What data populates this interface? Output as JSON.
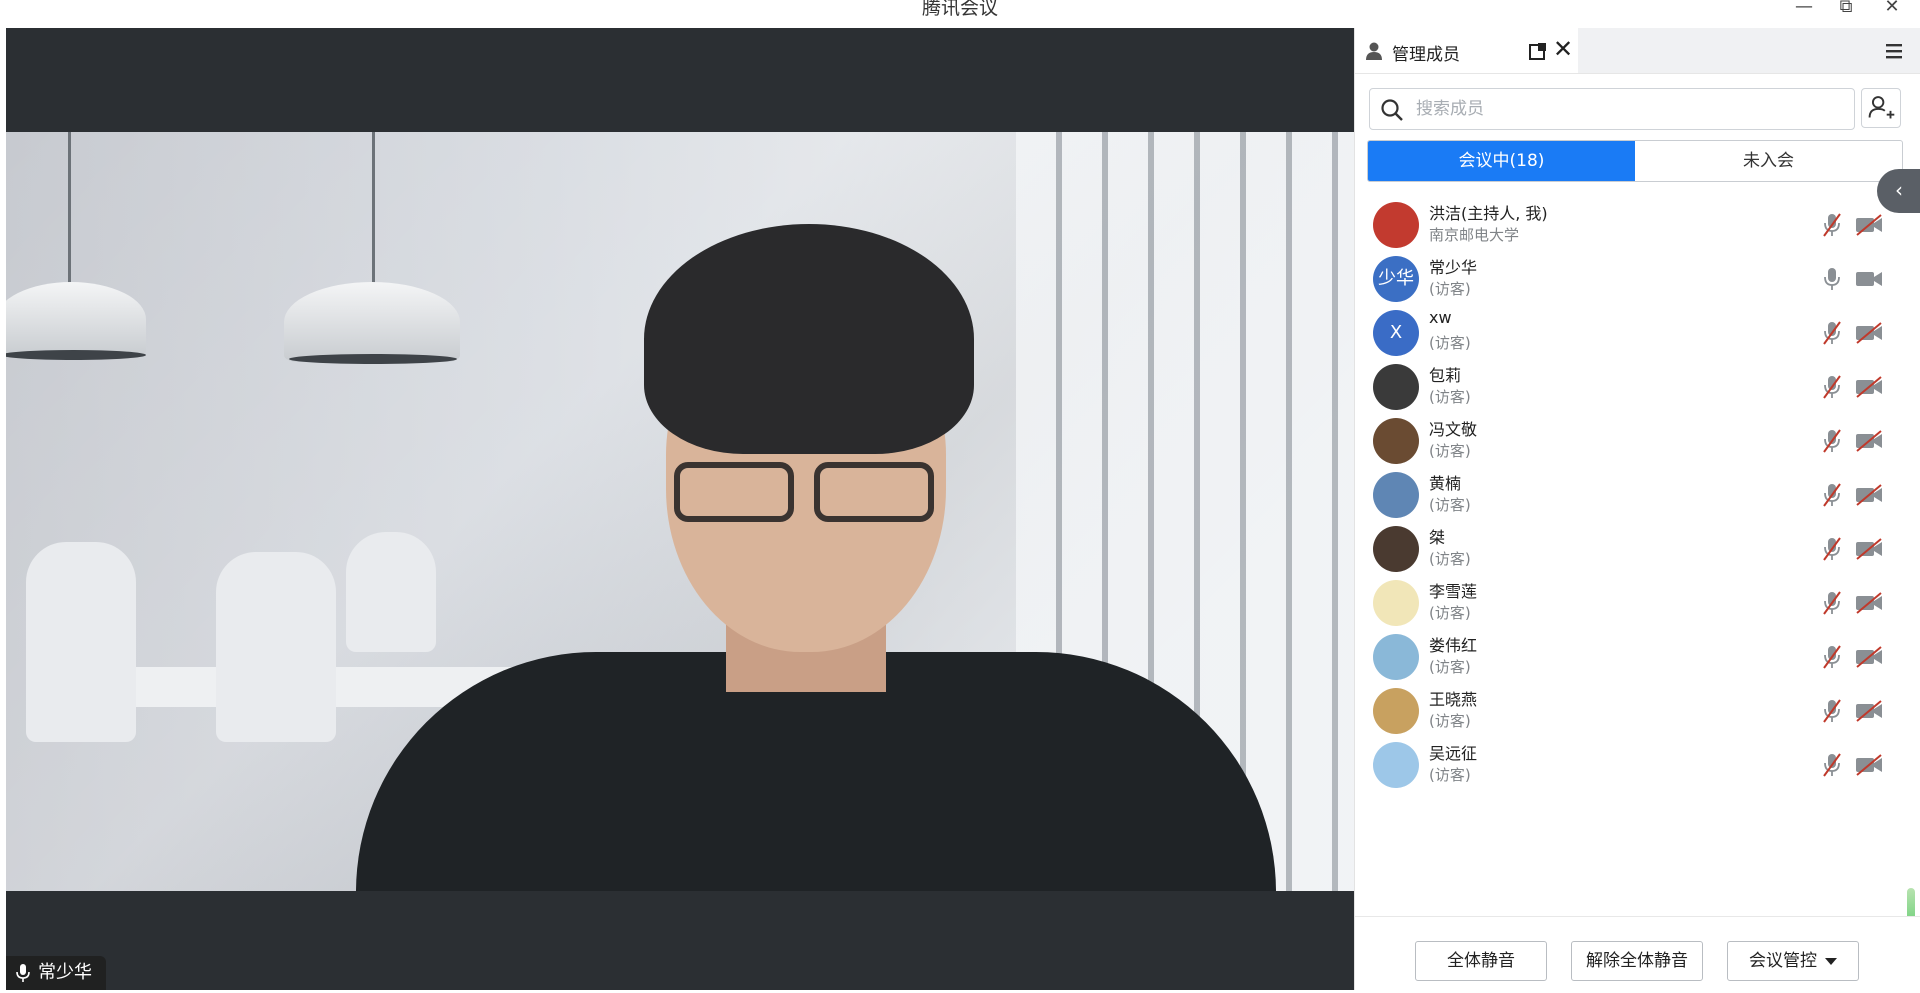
{
  "window": {
    "title": "腾讯会议",
    "min": "—",
    "max": "⧉",
    "close": "✕"
  },
  "video": {
    "speaker_name": "常少华"
  },
  "panel": {
    "tab_label": "管理成员",
    "search_placeholder": "搜索成员",
    "seg_in_meeting": "会议中(18)",
    "seg_not_joined": "未入会",
    "collapse_glyph": "‹",
    "members": [
      {
        "name": "洪洁(主持人, 我)",
        "sub": "南京邮电大学",
        "avatar_text": "",
        "avatar_color": "#c23a2f",
        "mic": "muted",
        "cam": "off"
      },
      {
        "name": "常少华",
        "sub": "(访客)",
        "avatar_text": "少华",
        "avatar_color": "#3b6fc4",
        "mic": "on",
        "cam": "on"
      },
      {
        "name": "xw",
        "sub": "(访客)",
        "avatar_text": "X",
        "avatar_color": "#3a6cc6",
        "mic": "muted",
        "cam": "off"
      },
      {
        "name": "包莉",
        "sub": "(访客)",
        "avatar_text": "",
        "avatar_color": "#3a3a3a",
        "mic": "muted",
        "cam": "off"
      },
      {
        "name": "冯文敬",
        "sub": "(访客)",
        "avatar_text": "",
        "avatar_color": "#6a4b32",
        "mic": "muted",
        "cam": "off"
      },
      {
        "name": "黄楠",
        "sub": "(访客)",
        "avatar_text": "",
        "avatar_color": "#5f86b4",
        "mic": "muted",
        "cam": "off"
      },
      {
        "name": "桀",
        "sub": "(访客)",
        "avatar_text": "",
        "avatar_color": "#4a3a30",
        "mic": "muted",
        "cam": "off"
      },
      {
        "name": "李雪莲",
        "sub": "(访客)",
        "avatar_text": "",
        "avatar_color": "#f1e6b8",
        "mic": "muted",
        "cam": "off"
      },
      {
        "name": "娄伟红",
        "sub": "(访客)",
        "avatar_text": "",
        "avatar_color": "#8ab8d8",
        "mic": "muted",
        "cam": "off"
      },
      {
        "name": "王晓燕",
        "sub": "(访客)",
        "avatar_text": "",
        "avatar_color": "#c8a160",
        "mic": "muted",
        "cam": "off"
      },
      {
        "name": "吴远征",
        "sub": "(访客)",
        "avatar_text": "",
        "avatar_color": "#9dc7e8",
        "mic": "muted",
        "cam": "off"
      }
    ],
    "btn_mute_all": "全体静音",
    "btn_unmute_all": "解除全体静音",
    "btn_meeting_control": "会议管控"
  }
}
